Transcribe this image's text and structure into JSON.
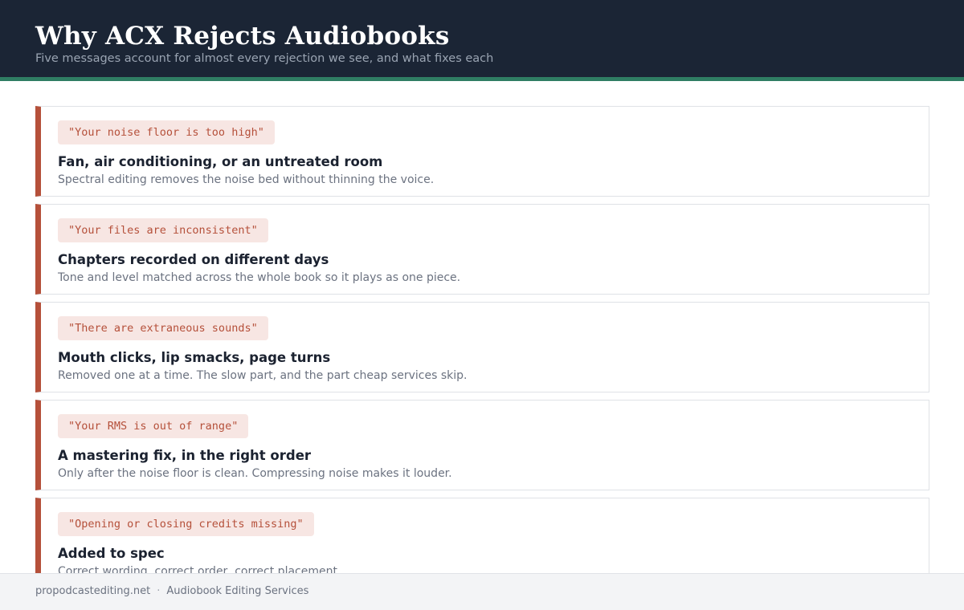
{
  "colors": {
    "header_bg": "#1b2535",
    "header_accent": "#2f7d63",
    "card_accent": "#b5503a",
    "quote_bg": "#f7e6e3"
  },
  "header": {
    "title": "Why ACX Rejects Audiobooks",
    "subtitle": "Five messages account for almost every rejection we see, and what fixes each"
  },
  "rejections": [
    {
      "message": "\"Your noise floor is too high\"",
      "cause": "Fan, air conditioning, or an untreated room",
      "fix": "Spectral editing removes the noise bed without thinning the voice."
    },
    {
      "message": "\"Your files are inconsistent\"",
      "cause": "Chapters recorded on different days",
      "fix": "Tone and level matched across the whole book so it plays as one piece."
    },
    {
      "message": "\"There are extraneous sounds\"",
      "cause": "Mouth clicks, lip smacks, page turns",
      "fix": "Removed one at a time. The slow part, and the part cheap services skip."
    },
    {
      "message": "\"Your RMS is out of range\"",
      "cause": "A mastering fix, in the right order",
      "fix": "Only after the noise floor is clean. Compressing noise makes it louder."
    },
    {
      "message": "\"Opening or closing credits missing\"",
      "cause": "Added to spec",
      "fix": "Correct wording, correct order, correct placement."
    }
  ],
  "footer": {
    "site": "propodcastediting.net",
    "separator": "·",
    "service": "Audiobook Editing Services"
  }
}
